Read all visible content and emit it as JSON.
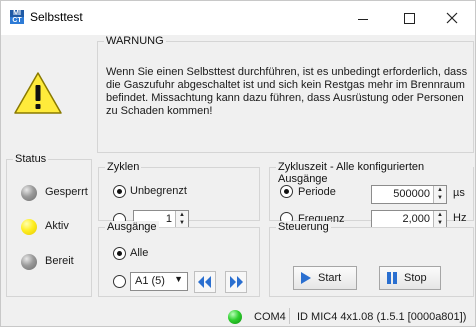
{
  "window": {
    "title": "Selbsttest",
    "icon_text": [
      "MI",
      "CT"
    ]
  },
  "warning": {
    "title": "WARNUNG",
    "text": "Wenn Sie einen Selbsttest durchführen, ist es unbedingt erforderlich, dass die Gaszufuhr abgeschaltet ist und sich kein Restgas mehr im Brennraum befindet. Missachtung kann dazu führen, dass Ausrüstung oder Personen zu Schaden kommen!"
  },
  "status": {
    "title": "Status",
    "items": [
      {
        "label": "Gesperrt",
        "color": "#8a8a8a"
      },
      {
        "label": "Aktiv",
        "color": "#ffee22"
      },
      {
        "label": "Bereit",
        "color": "#8a8a8a"
      }
    ]
  },
  "zyklen": {
    "title": "Zyklen",
    "option_unlimited": "Unbegrenzt",
    "count_value": "1",
    "selected": "unlimited"
  },
  "zykluszeit": {
    "title": "Zykluszeit - Alle konfigurierten Ausgänge",
    "periode_label": "Periode",
    "periode_value": "500000",
    "periode_unit": "µs",
    "frequenz_label": "Frequenz",
    "frequenz_value": "2,000",
    "frequenz_unit": "Hz",
    "selected": "periode"
  },
  "ausgaenge": {
    "title": "Ausgänge",
    "option_all": "Alle",
    "select_value": "A1 (5)",
    "selected": "all",
    "prev_icon": "double-left-arrow-icon",
    "next_icon": "double-right-arrow-icon"
  },
  "steuerung": {
    "title": "Steuerung",
    "start_label": "Start",
    "stop_label": "Stop",
    "start_icon": "play-icon",
    "stop_icon": "pause-icon"
  },
  "statusbar": {
    "port": "COM4",
    "id": "ID MIC4 4x1.08 (1.5.1 [0000a801])",
    "connection_color": "#2fcf2f"
  },
  "colors": {
    "accent": "#1f5aa6",
    "nav_button": "#2a6fd0"
  }
}
